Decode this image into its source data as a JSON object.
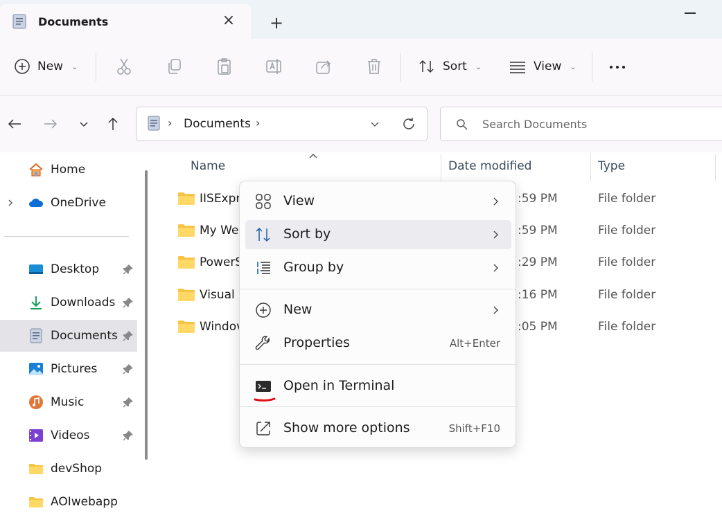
{
  "tab": {
    "title": "Documents",
    "close_glyph": "×",
    "new_tab_glyph": "+"
  },
  "toolbar": {
    "new_label": "New",
    "sort_label": "Sort",
    "view_label": "View",
    "chevron": "⌄",
    "icons": [
      "plus-circle-icon",
      "cut-icon",
      "copy-icon",
      "paste-icon",
      "rename-icon",
      "share-icon",
      "delete-icon",
      "sort-icon",
      "view-icon",
      "more-icon"
    ]
  },
  "address": {
    "crumb_sep": "›",
    "breadcrumb": [
      "Documents"
    ]
  },
  "search": {
    "placeholder": "Search Documents"
  },
  "sidebar": {
    "items": [
      {
        "label": "Home",
        "icon": "home-icon",
        "pinned": false
      },
      {
        "label": "OneDrive",
        "icon": "onedrive-icon",
        "pinned": false,
        "expandable": true
      },
      {
        "label": "Desktop",
        "icon": "desktop-icon",
        "pinned": true
      },
      {
        "label": "Downloads",
        "icon": "downloads-icon",
        "pinned": true
      },
      {
        "label": "Documents",
        "icon": "documents-icon",
        "pinned": true,
        "selected": true
      },
      {
        "label": "Pictures",
        "icon": "pictures-icon",
        "pinned": true
      },
      {
        "label": "Music",
        "icon": "music-icon",
        "pinned": true
      },
      {
        "label": "Videos",
        "icon": "videos-icon",
        "pinned": true
      },
      {
        "label": "devShop",
        "icon": "folder-icon",
        "pinned": false
      },
      {
        "label": "AOIwebapp",
        "icon": "folder-icon",
        "pinned": false
      }
    ]
  },
  "filelist": {
    "columns": {
      "name": "Name",
      "date": "Date modified",
      "type": "Type"
    },
    "rows": [
      {
        "name": "IISExpre",
        "date": ":59 PM",
        "type": "File folder"
      },
      {
        "name": "My We",
        "date": ":59 PM",
        "type": "File folder"
      },
      {
        "name": "PowerS",
        "date": ":29 PM",
        "type": "File folder"
      },
      {
        "name": "Visual S",
        "date": ":16 PM",
        "type": "File folder"
      },
      {
        "name": "Windov",
        "date": ":05 PM",
        "type": "File folder"
      }
    ]
  },
  "context_menu": {
    "items": [
      {
        "label": "View",
        "icon": "view-grid-icon",
        "submenu": true
      },
      {
        "label": "Sort by",
        "icon": "sort-icon",
        "submenu": true,
        "hover": true
      },
      {
        "label": "Group by",
        "icon": "group-by-icon",
        "submenu": true
      },
      {
        "label": "New",
        "icon": "plus-circle-icon",
        "submenu": true
      },
      {
        "label": "Properties",
        "icon": "wrench-icon",
        "shortcut": "Alt+Enter"
      },
      {
        "label": "Open in Terminal",
        "icon": "terminal-icon"
      },
      {
        "label": "Show more options",
        "icon": "show-more-icon",
        "shortcut": "Shift+F10"
      }
    ]
  },
  "colors": {
    "accent": "#0067c0",
    "folder": "#f6c343",
    "highlight_underline": "#e0101a",
    "selected_bg": "#e4e4e8",
    "hover_bg": "#ececf0"
  }
}
